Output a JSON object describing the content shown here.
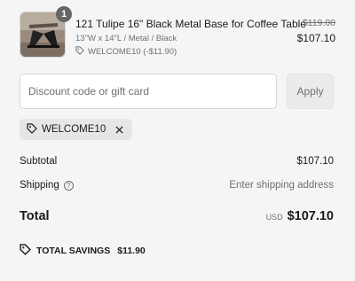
{
  "product": {
    "quantity": "1",
    "title": "121 Tulipe 16\" Black Metal Base for Coffee Table",
    "variant": "13\"W x 14\"L / Metal / Black",
    "discount": "WELCOME10 (-$11.90)",
    "compare_price": "$119.00",
    "price": "$107.10"
  },
  "discount_form": {
    "placeholder": "Discount code or gift card",
    "value": "",
    "apply_label": "Apply"
  },
  "applied_code": "WELCOME10",
  "summary": {
    "subtotal_label": "Subtotal",
    "subtotal_value": "$107.10",
    "shipping_label": "Shipping",
    "shipping_value": "Enter shipping address",
    "total_label": "Total",
    "currency": "USD",
    "total_value": "$107.10"
  },
  "savings": {
    "label": "TOTAL SAVINGS",
    "amount": "$11.90"
  },
  "icons": {
    "tag": "tag-icon",
    "close": "close-icon",
    "info": "info-icon"
  }
}
